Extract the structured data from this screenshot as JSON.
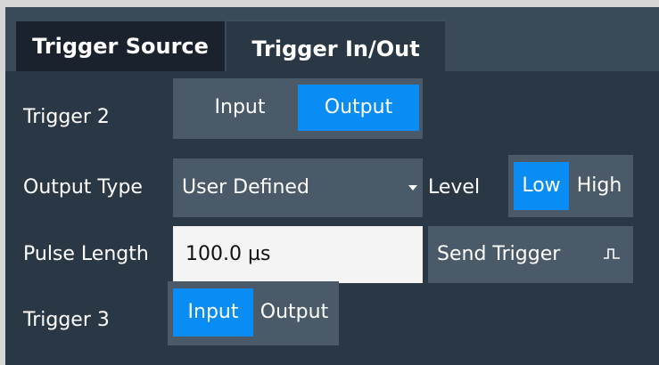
{
  "tabs": [
    {
      "label": "Trigger Source",
      "active": false
    },
    {
      "label": "Trigger In/Out",
      "active": true
    }
  ],
  "trigger2": {
    "label": "Trigger 2",
    "options": [
      "Input",
      "Output"
    ],
    "selected": "Output"
  },
  "output_type": {
    "label": "Output Type",
    "value": "User Defined"
  },
  "level": {
    "label": "Level",
    "options": [
      "Low",
      "High"
    ],
    "selected": "Low"
  },
  "pulse_length": {
    "label": "Pulse Length",
    "value": "100.0 µs"
  },
  "send_trigger": {
    "label": "Send Trigger",
    "icon": "pulse-icon"
  },
  "trigger3": {
    "label": "Trigger 3",
    "options": [
      "Input",
      "Output"
    ],
    "selected": "Input"
  },
  "colors": {
    "selected": "#0a8cf5",
    "control_bg": "#4a5a68",
    "panel_bg": "#2a3845"
  }
}
